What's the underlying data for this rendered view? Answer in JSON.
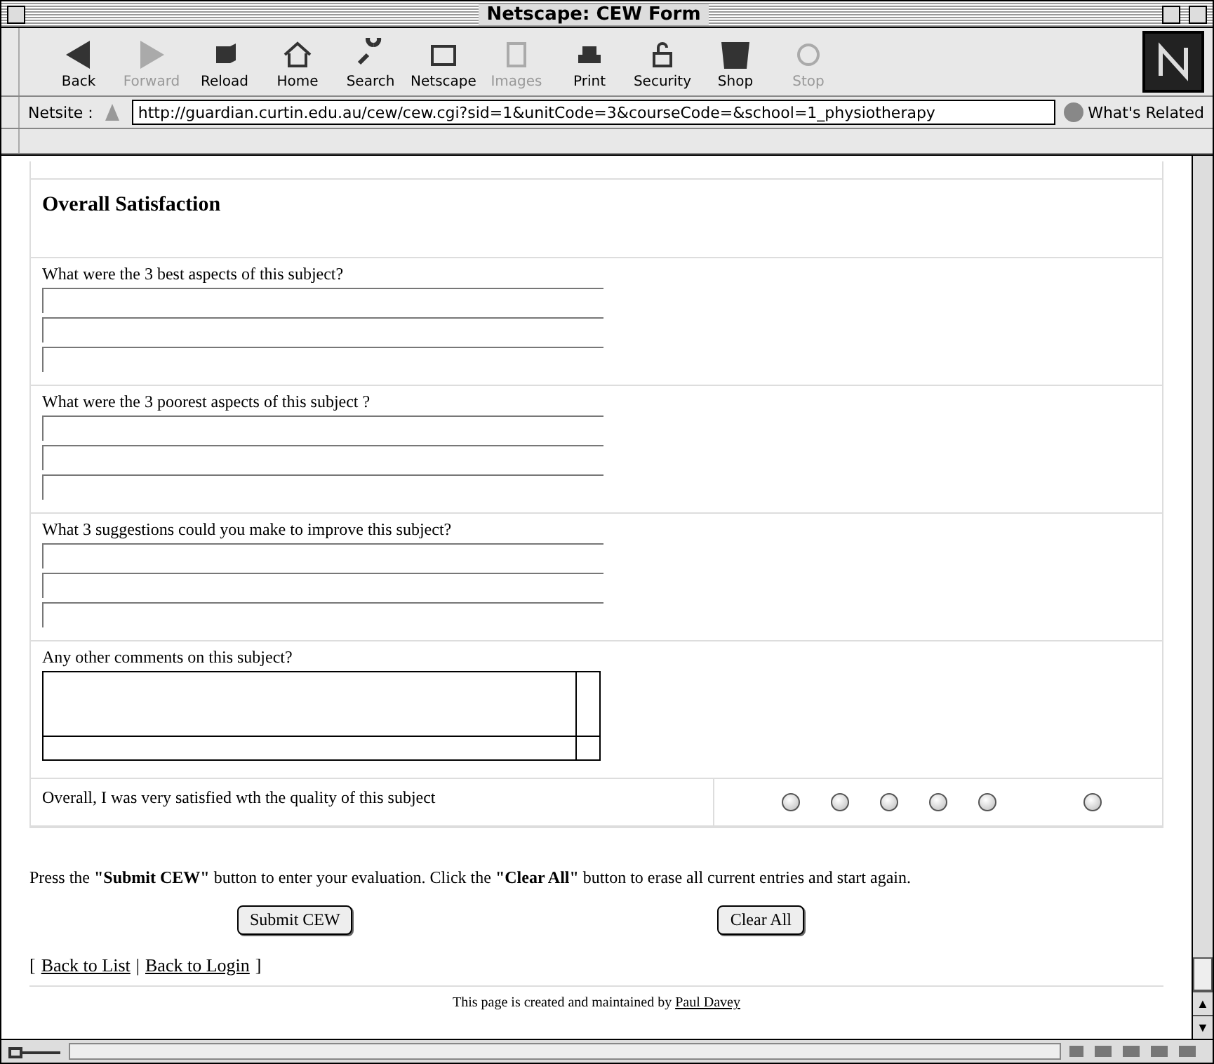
{
  "window": {
    "title": "Netscape: CEW Form"
  },
  "toolbar": [
    {
      "label": "Back",
      "disabled": false
    },
    {
      "label": "Forward",
      "disabled": true
    },
    {
      "label": "Reload",
      "disabled": false
    },
    {
      "label": "Home",
      "disabled": false
    },
    {
      "label": "Search",
      "disabled": false
    },
    {
      "label": "Netscape",
      "disabled": false
    },
    {
      "label": "Images",
      "disabled": true
    },
    {
      "label": "Print",
      "disabled": false
    },
    {
      "label": "Security",
      "disabled": false
    },
    {
      "label": "Shop",
      "disabled": false
    },
    {
      "label": "Stop",
      "disabled": true
    }
  ],
  "location": {
    "label": "Netsite :",
    "url": "http://guardian.curtin.edu.au/cew/cew.cgi?sid=1&unitCode=3&courseCode=&school=1_physiotherapy",
    "whats_related": "What's Related"
  },
  "form": {
    "heading": "Overall Satisfaction",
    "questions": [
      {
        "kind": "lines",
        "label": "What were the 3 best aspects of this subject?"
      },
      {
        "kind": "lines",
        "label": "What were the 3 poorest aspects of this subject ?"
      },
      {
        "kind": "lines",
        "label": "What 3 suggestions could you make to improve this subject?"
      },
      {
        "kind": "textarea",
        "label": "Any other comments on this subject?"
      }
    ],
    "rating": {
      "label": "Overall, I was very satisfied wth the quality of this subject",
      "options": [
        {
          "selected": false
        },
        {
          "selected": false
        },
        {
          "selected": false
        },
        {
          "selected": false
        },
        {
          "selected": false
        },
        {
          "selected": false
        }
      ]
    }
  },
  "instructions": "Press the **\"Submit CEW\"** button to enter your evaluation. Click the **\"Clear All\"** button to erase all current entries and start again.",
  "buttons": [
    "Submit CEW",
    "Clear All"
  ],
  "links": [
    "Back to List",
    "Back to Login"
  ],
  "link_marks": {
    "open": "[",
    "separator": "|",
    "close": "]"
  },
  "scroll_arrows": [
    "▲",
    "▼"
  ],
  "footer": {
    "text": "This page is created and maintained by",
    "link": "Paul Davey"
  }
}
